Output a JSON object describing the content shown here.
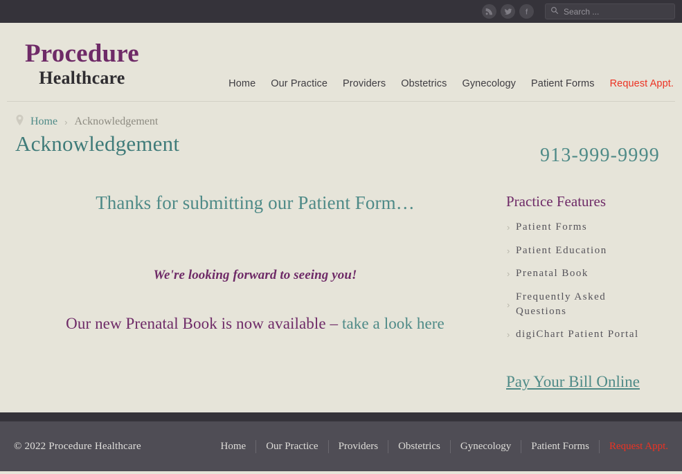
{
  "topbar": {
    "social": [
      {
        "name": "rss-icon",
        "label": "RSS"
      },
      {
        "name": "twitter-icon",
        "label": "Twitter"
      },
      {
        "name": "facebook-icon",
        "label": "Facebook"
      }
    ],
    "search": {
      "placeholder": "Search ...",
      "value": "",
      "icon": "search-icon"
    }
  },
  "brand": {
    "line1": "Procedure",
    "line2": "Healthcare",
    "color_line1": "#6e2a67",
    "color_line2": "#2f2d31"
  },
  "mainnav": {
    "items": [
      {
        "label": "Home",
        "accent": false
      },
      {
        "label": "Our Practice",
        "accent": false
      },
      {
        "label": "Providers",
        "accent": false
      },
      {
        "label": "Obstetrics",
        "accent": false
      },
      {
        "label": "Gynecology",
        "accent": false
      },
      {
        "label": "Patient Forms",
        "accent": false
      },
      {
        "label": "Request Appt.",
        "accent": true
      }
    ],
    "accent_color": "#ec3223"
  },
  "breadcrumb": {
    "icon": "map-pin-icon",
    "home": "Home",
    "separator": "›",
    "current": "Acknowledgement"
  },
  "main": {
    "title": "Acknowledgement",
    "lead": "Thanks for submitting our Patient Form…",
    "tagline": "We're looking forward to seeing you!",
    "promo_text": "Our new Prenatal Book is now available – ",
    "promo_link": "take a look here",
    "teal": "#4e8a87",
    "purple": "#6e2a67"
  },
  "sidebar": {
    "phone": "913-999-9999",
    "features_title": "Practice Features",
    "features": [
      {
        "label": "Patient Forms"
      },
      {
        "label": "Patient Education"
      },
      {
        "label": "Prenatal Book"
      },
      {
        "label": "Frequently Asked Questions"
      },
      {
        "label": "digiChart Patient Portal"
      }
    ],
    "chevron": "›",
    "pay_bill": "Pay Your Bill Online"
  },
  "footer": {
    "copyright": "© 2022 Procedure Healthcare",
    "nav": [
      {
        "label": "Home",
        "accent": false
      },
      {
        "label": "Our Practice",
        "accent": false
      },
      {
        "label": "Providers",
        "accent": false
      },
      {
        "label": "Obstetrics",
        "accent": false
      },
      {
        "label": "Gynecology",
        "accent": false
      },
      {
        "label": "Patient Forms",
        "accent": false
      },
      {
        "label": "Request Appt.",
        "accent": true
      }
    ]
  }
}
